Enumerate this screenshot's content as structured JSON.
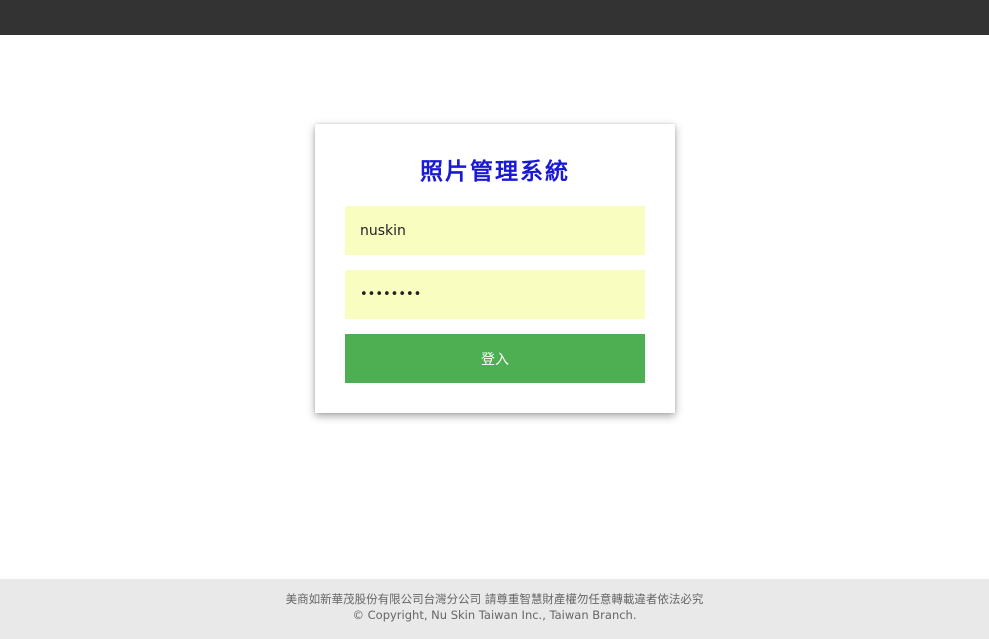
{
  "login": {
    "title": "照片管理系統",
    "username_value": "nuskin",
    "password_value": "••••••••",
    "login_button_label": "登入"
  },
  "footer": {
    "line1": "美商如新華茂股份有限公司台灣分公司 請尊重智慧財產權勿任意轉載違者依法必究",
    "line2": "© Copyright, Nu Skin Taiwan Inc., Taiwan Branch."
  },
  "colors": {
    "topbar": "#333333",
    "title": "#1a1ad6",
    "input_bg": "#f9fdc0",
    "button_bg": "#4eae52",
    "footer_bg": "#e9e9e9"
  }
}
